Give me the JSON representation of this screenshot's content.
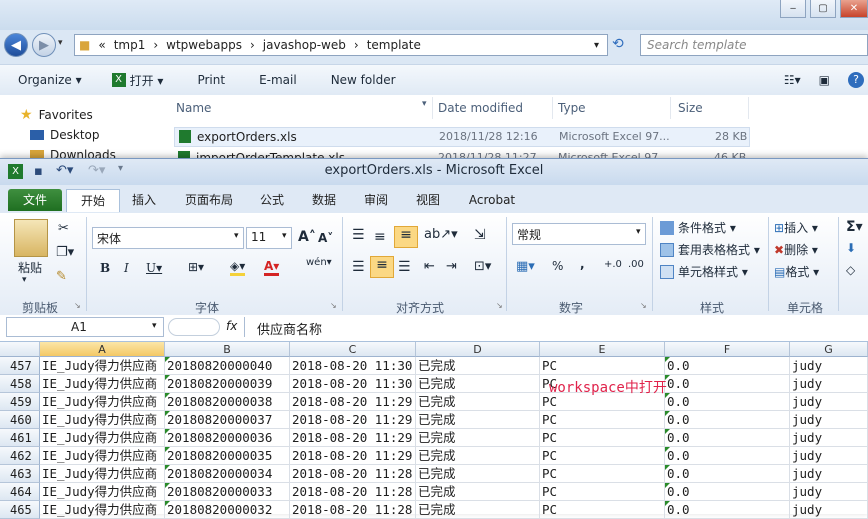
{
  "explorer": {
    "breadcrumb": [
      "tmp1",
      "wtpwebapps",
      "javashop-web",
      "template"
    ],
    "search_placeholder": "Search template",
    "commands": [
      "Organize ▾",
      "打开 ▾",
      "Print",
      "E-mail",
      "New folder"
    ],
    "nav": {
      "favorites": "Favorites",
      "desktop": "Desktop",
      "downloads": "Downloads"
    },
    "columns": [
      "Name",
      "Date modified",
      "Type",
      "Size"
    ],
    "files": [
      {
        "name": "exportOrders.xls",
        "date": "2018/11/28 12:16",
        "type": "Microsoft Excel 97...",
        "size": "28 KB"
      },
      {
        "name": "importOrderTemplate.xls",
        "date": "2018/11/28 11:27",
        "type": "Microsoft Excel 97...",
        "size": "46 KB"
      }
    ]
  },
  "excel": {
    "title": "exportOrders.xls  -  Microsoft Excel",
    "tabs": [
      "文件",
      "开始",
      "插入",
      "页面布局",
      "公式",
      "数据",
      "审阅",
      "视图",
      "Acrobat"
    ],
    "ribbon": {
      "paste": "粘贴",
      "font_name": "宋体",
      "font_size": "11",
      "number_format": "常规",
      "cond_format": "条件格式 ▾",
      "table_format": "套用表格格式 ▾",
      "cell_style": "单元格样式 ▾",
      "insert": "插入 ▾",
      "delete": "删除 ▾",
      "format": "格式 ▾",
      "groups": [
        "剪贴板",
        "字体",
        "对齐方式",
        "数字",
        "样式",
        "单元格"
      ]
    },
    "name_box": "A1",
    "formula": "供应商名称",
    "columns": [
      "A",
      "B",
      "C",
      "D",
      "E",
      "F",
      "G"
    ],
    "rows": [
      {
        "num": "457",
        "a": "IE_Judy得力供应商",
        "b": "20180820000040",
        "c": "2018-08-20 11:30",
        "d": "已完成",
        "e": "PC",
        "f": "0.0",
        "g": "judy"
      },
      {
        "num": "458",
        "a": "IE_Judy得力供应商",
        "b": "20180820000039",
        "c": "2018-08-20 11:30",
        "d": "已完成",
        "e": "PC",
        "f": "0.0",
        "g": "judy"
      },
      {
        "num": "459",
        "a": "IE_Judy得力供应商",
        "b": "20180820000038",
        "c": "2018-08-20 11:29",
        "d": "已完成",
        "e": "PC",
        "f": "0.0",
        "g": "judy"
      },
      {
        "num": "460",
        "a": "IE_Judy得力供应商",
        "b": "20180820000037",
        "c": "2018-08-20 11:29",
        "d": "已完成",
        "e": "PC",
        "f": "0.0",
        "g": "judy"
      },
      {
        "num": "461",
        "a": "IE_Judy得力供应商",
        "b": "20180820000036",
        "c": "2018-08-20 11:29",
        "d": "已完成",
        "e": "PC",
        "f": "0.0",
        "g": "judy"
      },
      {
        "num": "462",
        "a": "IE_Judy得力供应商",
        "b": "20180820000035",
        "c": "2018-08-20 11:29",
        "d": "已完成",
        "e": "PC",
        "f": "0.0",
        "g": "judy"
      },
      {
        "num": "463",
        "a": "IE_Judy得力供应商",
        "b": "20180820000034",
        "c": "2018-08-20 11:28",
        "d": "已完成",
        "e": "PC",
        "f": "0.0",
        "g": "judy"
      },
      {
        "num": "464",
        "a": "IE_Judy得力供应商",
        "b": "20180820000033",
        "c": "2018-08-20 11:28",
        "d": "已完成",
        "e": "PC",
        "f": "0.0",
        "g": "judy"
      },
      {
        "num": "465",
        "a": "IE_Judy得力供应商",
        "b": "20180820000032",
        "c": "2018-08-20 11:28",
        "d": "已完成",
        "e": "PC",
        "f": "0.0",
        "g": "judy"
      }
    ]
  },
  "annotation": "workspace中打开",
  "colors": {
    "excel_green": "#1f6f21",
    "annotation": "#e0234b"
  }
}
